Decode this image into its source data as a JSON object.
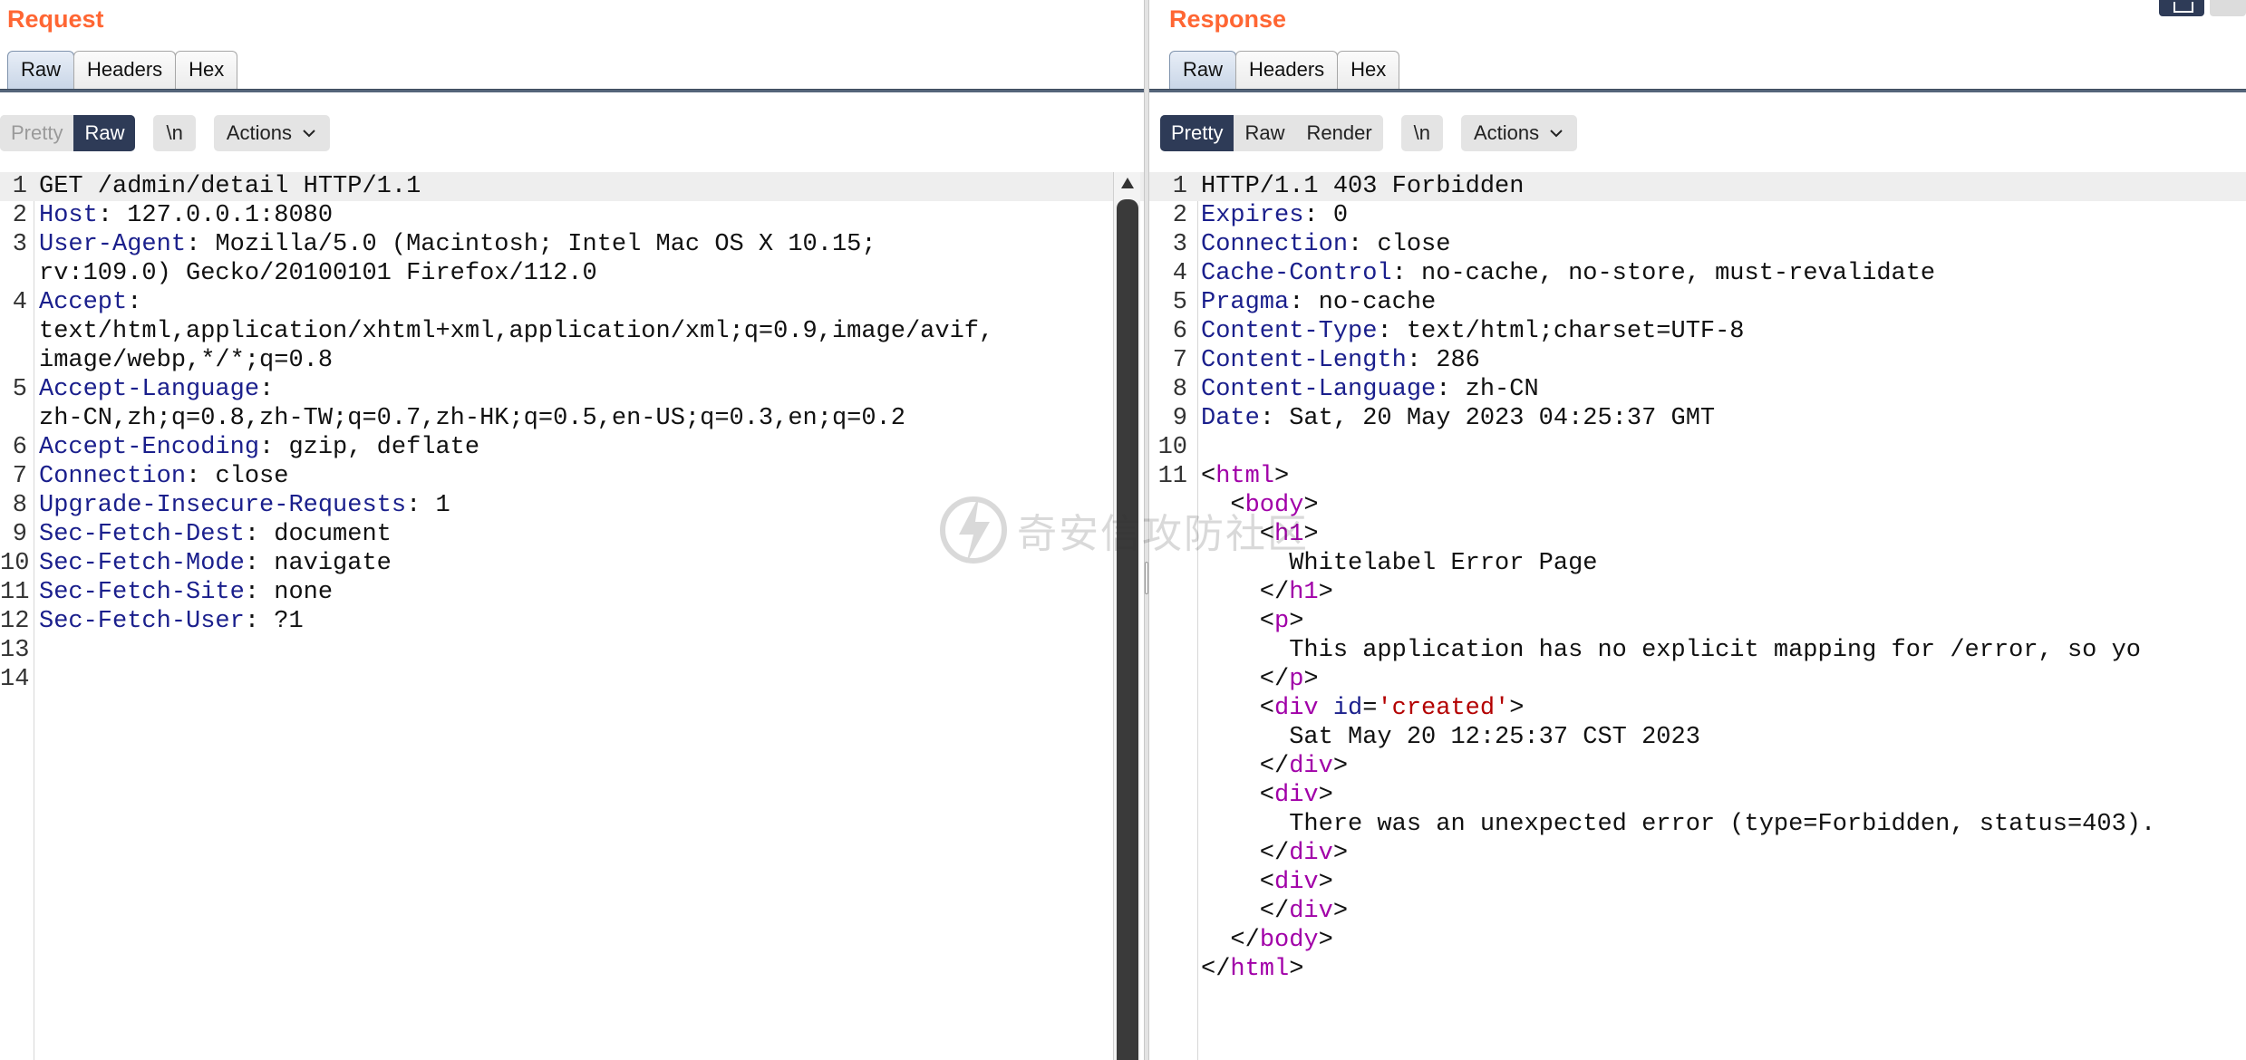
{
  "request": {
    "title": "Request",
    "tabs": [
      "Raw",
      "Headers",
      "Hex"
    ],
    "active_tab": "Raw",
    "view_modes": [
      "Pretty",
      "Raw"
    ],
    "active_view_mode": "Raw",
    "newline_toggle": "\\n",
    "actions_label": "Actions",
    "lines": [
      {
        "n": "1",
        "key": "",
        "text": "GET /admin/detail HTTP/1.1"
      },
      {
        "n": "2",
        "key": "Host",
        "text": "127.0.0.1:8080"
      },
      {
        "n": "3",
        "key": "User-Agent",
        "text": "Mozilla/5.0 (Macintosh; Intel Mac OS X 10.15;",
        "cont": "rv:109.0) Gecko/20100101 Firefox/112.0"
      },
      {
        "n": "4",
        "key": "Accept",
        "text": "",
        "cont": "text/html,application/xhtml+xml,application/xml;q=0.9,image/avif,",
        "cont2": "image/webp,*/*;q=0.8"
      },
      {
        "n": "5",
        "key": "Accept-Language",
        "text": "",
        "cont": "zh-CN,zh;q=0.8,zh-TW;q=0.7,zh-HK;q=0.5,en-US;q=0.3,en;q=0.2"
      },
      {
        "n": "6",
        "key": "Accept-Encoding",
        "text": "gzip, deflate"
      },
      {
        "n": "7",
        "key": "Connection",
        "text": "close"
      },
      {
        "n": "8",
        "key": "Upgrade-Insecure-Requests",
        "text": "1"
      },
      {
        "n": "9",
        "key": "Sec-Fetch-Dest",
        "text": "document"
      },
      {
        "n": "10",
        "key": "Sec-Fetch-Mode",
        "text": "navigate"
      },
      {
        "n": "11",
        "key": "Sec-Fetch-Site",
        "text": "none"
      },
      {
        "n": "12",
        "key": "Sec-Fetch-User",
        "text": "?1"
      },
      {
        "n": "13",
        "key": "",
        "text": ""
      },
      {
        "n": "14",
        "key": "",
        "text": ""
      }
    ]
  },
  "response": {
    "title": "Response",
    "tabs": [
      "Raw",
      "Headers",
      "Hex"
    ],
    "active_tab": "Raw",
    "view_modes": [
      "Pretty",
      "Raw",
      "Render"
    ],
    "active_view_mode": "Pretty",
    "newline_toggle": "\\n",
    "actions_label": "Actions",
    "header_lines": [
      {
        "n": "1",
        "key": "",
        "text": "HTTP/1.1 403 Forbidden"
      },
      {
        "n": "2",
        "key": "Expires",
        "text": "0"
      },
      {
        "n": "3",
        "key": "Connection",
        "text": "close"
      },
      {
        "n": "4",
        "key": "Cache-Control",
        "text": "no-cache, no-store, must-revalidate"
      },
      {
        "n": "5",
        "key": "Pragma",
        "text": "no-cache"
      },
      {
        "n": "6",
        "key": "Content-Type",
        "text": "text/html;charset=UTF-8"
      },
      {
        "n": "7",
        "key": "Content-Length",
        "text": "286"
      },
      {
        "n": "8",
        "key": "Content-Language",
        "text": "zh-CN"
      },
      {
        "n": "9",
        "key": "Date",
        "text": "Sat, 20 May 2023 04:25:37 GMT"
      },
      {
        "n": "10",
        "key": "",
        "text": ""
      },
      {
        "n": "11",
        "key": "",
        "text": ""
      }
    ],
    "body": {
      "html_tag": "html",
      "body_tag": "body",
      "h1_tag": "h1",
      "h1_text": "Whitelabel Error Page",
      "p_tag": "p",
      "p_text": "This application has no explicit mapping for /error, so yo",
      "div_tag": "div",
      "id_attr": "id",
      "id_value": "'created'",
      "created_text": "Sat May 20 12:25:37 CST 2023",
      "error_text": "There was an unexpected error (type=Forbidden, status=403)."
    }
  },
  "watermark": "奇安信攻防社区",
  "colors": {
    "title_orange": "#ff6633",
    "active_dark": "#2e3b57",
    "header_key": "#1a1f8c",
    "html_tag": "#a100a8",
    "attr_string": "#b30000"
  }
}
